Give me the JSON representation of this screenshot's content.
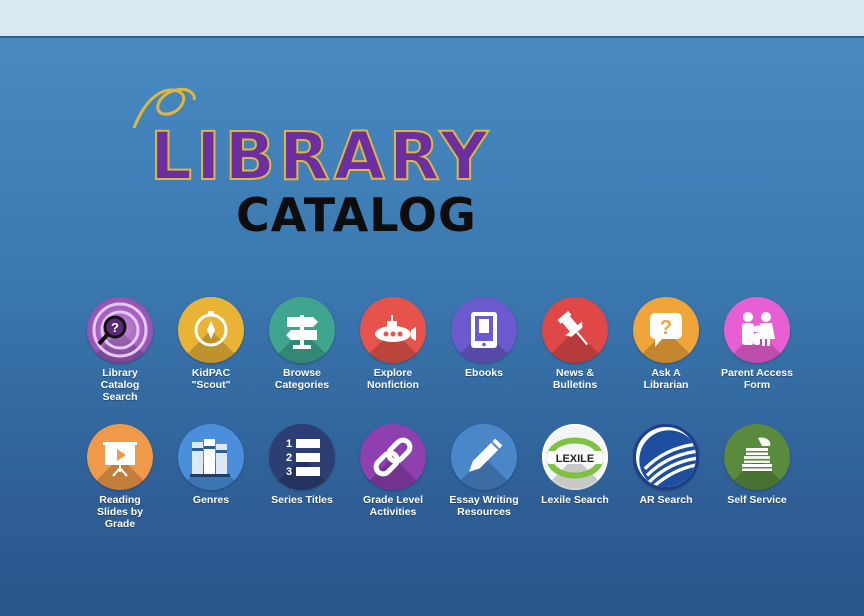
{
  "logo": {
    "title": "LIBRARY",
    "subtitle": "CATALOG"
  },
  "colors": {
    "background": "#3b78b0",
    "library_fill": "#6b2fa0",
    "library_outline": "#e0b63c"
  },
  "row1": [
    {
      "label": "Library\nCatalog\nSearch",
      "icon": "catalog-search-icon",
      "color": "#9b59b6"
    },
    {
      "label": "KidPAC\n\"Scout\"",
      "icon": "compass-icon",
      "color": "#e9b436"
    },
    {
      "label": "Browse\nCategories",
      "icon": "signpost-icon",
      "color": "#3fa58f"
    },
    {
      "label": "Explore\nNonfiction",
      "icon": "submarine-icon",
      "color": "#e5534b"
    },
    {
      "label": "Ebooks",
      "icon": "tablet-book-icon",
      "color": "#6a5acd"
    },
    {
      "label": "News &\nBulletins",
      "icon": "pushpin-icon",
      "color": "#e04848"
    },
    {
      "label": "Ask A\nLibrarian",
      "icon": "question-bubble-icon",
      "color": "#f0a53a"
    },
    {
      "label": "Parent Access\nForm",
      "icon": "family-icon",
      "color": "#e85fd3"
    }
  ],
  "row2": [
    {
      "label": "Reading\nSlides by\nGrade",
      "icon": "presentation-icon",
      "color": "#ef9a4a"
    },
    {
      "label": "Genres",
      "icon": "books-icon",
      "color": "#4b8fdc"
    },
    {
      "label": "Series Titles",
      "icon": "numbered-list-icon",
      "color": "#2c3e73"
    },
    {
      "label": "Grade Level\nActivities",
      "icon": "link-icon",
      "color": "#8e3fb0"
    },
    {
      "label": "Essay Writing\nResources",
      "icon": "pencil-icon",
      "color": "#4a86c8"
    },
    {
      "label": "Lexile Search",
      "icon": "lexile-icon",
      "color": "#ffffff"
    },
    {
      "label": "AR Search",
      "icon": "ar-logo-icon",
      "color": "#ffffff"
    },
    {
      "label": "Self Service",
      "icon": "book-stack-icon",
      "color": "#5a8a3c"
    }
  ],
  "lexile_text": "LEXILE"
}
